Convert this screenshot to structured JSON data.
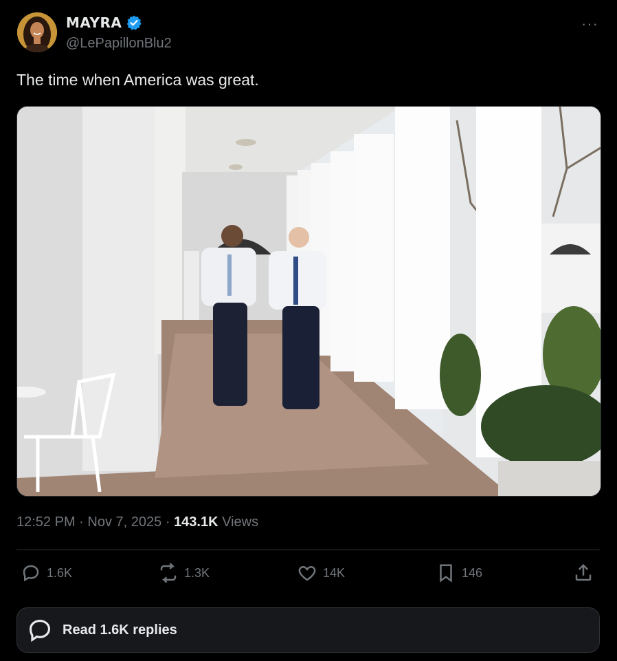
{
  "author": {
    "display_name": "MAYRA",
    "handle": "@LePapillonBlu2",
    "verified": true
  },
  "more_icon": "···",
  "tweet": {
    "text": "The time when America was great."
  },
  "media": {
    "icon": "photo"
  },
  "meta": {
    "time": "12:52 PM",
    "sep1": "·",
    "date": "Nov 7, 2025",
    "sep2": "·",
    "views_count": "143.1K",
    "views_label": "Views"
  },
  "actions": {
    "replies": "1.6K",
    "reposts": "1.3K",
    "likes": "14K",
    "bookmarks": "146"
  },
  "read_replies": {
    "label": "Read 1.6K replies"
  },
  "colors": {
    "background": "#000000",
    "text_primary": "#e7e9ea",
    "text_secondary": "#71767b",
    "verified_blue": "#1d9bf0",
    "card_bg": "#16181c",
    "border": "#2f3336"
  }
}
